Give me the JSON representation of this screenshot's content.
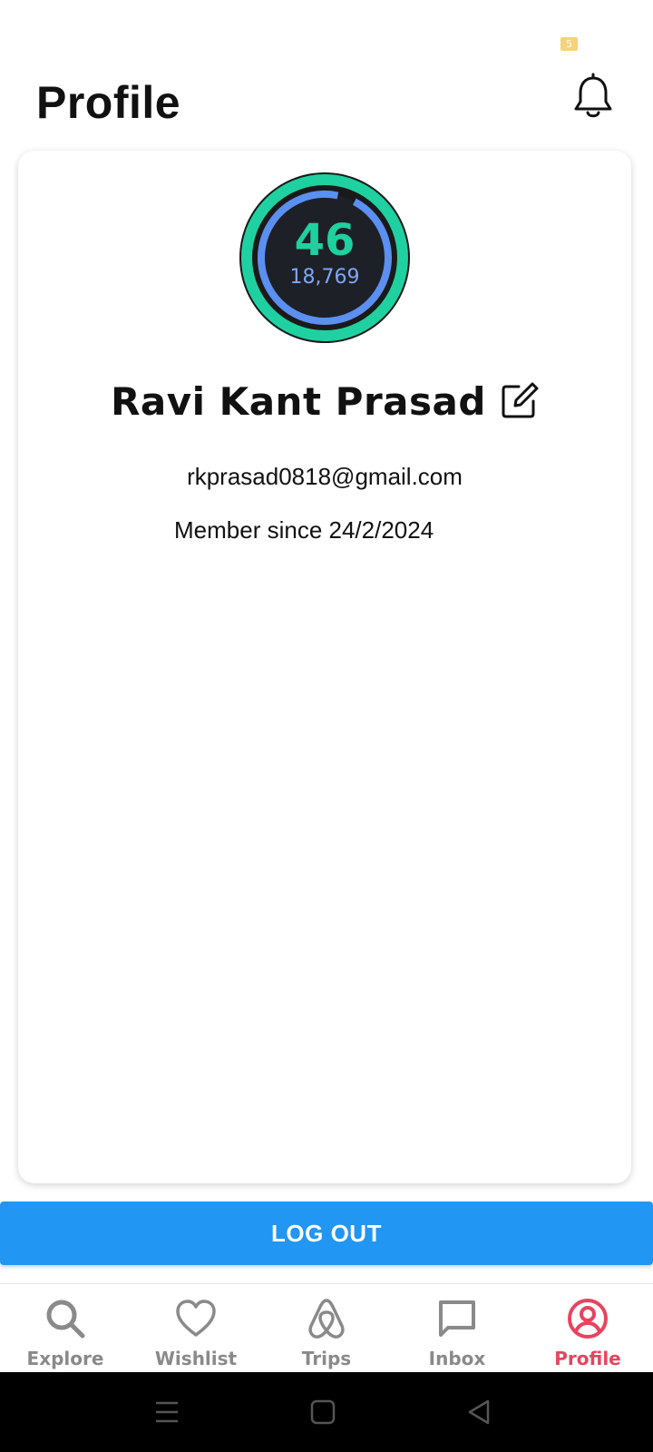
{
  "status_bar": {
    "battery_level": "5"
  },
  "header": {
    "title": "Profile"
  },
  "profile": {
    "avatar_score": "46",
    "avatar_subtext": "18,769",
    "name": "Ravi Kant Prasad",
    "email": "rkprasad0818@gmail.com",
    "member_since": "Member since 24/2/2024"
  },
  "actions": {
    "logout_label": "LOG OUT"
  },
  "bottom_nav": {
    "items": [
      {
        "label": "Explore",
        "icon": "search-icon"
      },
      {
        "label": "Wishlist",
        "icon": "heart-icon"
      },
      {
        "label": "Trips",
        "icon": "airbnb-logo-icon"
      },
      {
        "label": "Inbox",
        "icon": "chat-bubble-icon"
      },
      {
        "label": "Profile",
        "icon": "user-circle-icon",
        "active": true
      }
    ]
  },
  "colors": {
    "accent_blue": "#2196f3",
    "active_nav": "#e8445f",
    "inactive_nav": "#8a8a8a",
    "ring_green": "#1fd1a0",
    "ring_blue": "#5b8ff0"
  }
}
